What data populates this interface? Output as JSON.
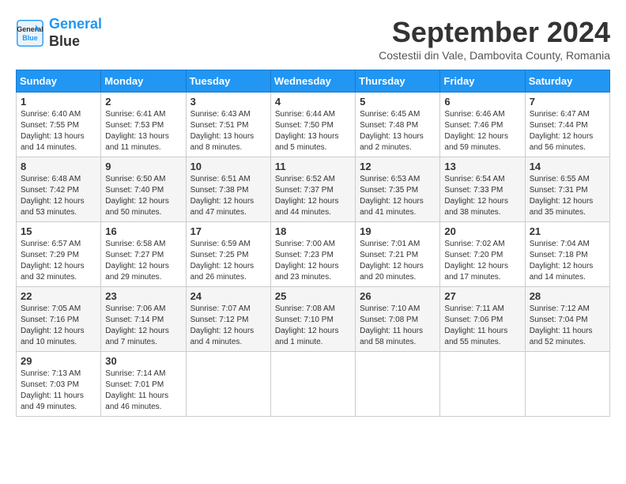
{
  "header": {
    "logo_line1": "General",
    "logo_line2": "Blue",
    "month_year": "September 2024",
    "location": "Costestii din Vale, Dambovita County, Romania"
  },
  "weekdays": [
    "Sunday",
    "Monday",
    "Tuesday",
    "Wednesday",
    "Thursday",
    "Friday",
    "Saturday"
  ],
  "weeks": [
    [
      {
        "day": 1,
        "sunrise": "6:40 AM",
        "sunset": "7:55 PM",
        "daylight": "13 hours and 14 minutes."
      },
      {
        "day": 2,
        "sunrise": "6:41 AM",
        "sunset": "7:53 PM",
        "daylight": "13 hours and 11 minutes."
      },
      {
        "day": 3,
        "sunrise": "6:43 AM",
        "sunset": "7:51 PM",
        "daylight": "13 hours and 8 minutes."
      },
      {
        "day": 4,
        "sunrise": "6:44 AM",
        "sunset": "7:50 PM",
        "daylight": "13 hours and 5 minutes."
      },
      {
        "day": 5,
        "sunrise": "6:45 AM",
        "sunset": "7:48 PM",
        "daylight": "13 hours and 2 minutes."
      },
      {
        "day": 6,
        "sunrise": "6:46 AM",
        "sunset": "7:46 PM",
        "daylight": "12 hours and 59 minutes."
      },
      {
        "day": 7,
        "sunrise": "6:47 AM",
        "sunset": "7:44 PM",
        "daylight": "12 hours and 56 minutes."
      }
    ],
    [
      {
        "day": 8,
        "sunrise": "6:48 AM",
        "sunset": "7:42 PM",
        "daylight": "12 hours and 53 minutes."
      },
      {
        "day": 9,
        "sunrise": "6:50 AM",
        "sunset": "7:40 PM",
        "daylight": "12 hours and 50 minutes."
      },
      {
        "day": 10,
        "sunrise": "6:51 AM",
        "sunset": "7:38 PM",
        "daylight": "12 hours and 47 minutes."
      },
      {
        "day": 11,
        "sunrise": "6:52 AM",
        "sunset": "7:37 PM",
        "daylight": "12 hours and 44 minutes."
      },
      {
        "day": 12,
        "sunrise": "6:53 AM",
        "sunset": "7:35 PM",
        "daylight": "12 hours and 41 minutes."
      },
      {
        "day": 13,
        "sunrise": "6:54 AM",
        "sunset": "7:33 PM",
        "daylight": "12 hours and 38 minutes."
      },
      {
        "day": 14,
        "sunrise": "6:55 AM",
        "sunset": "7:31 PM",
        "daylight": "12 hours and 35 minutes."
      }
    ],
    [
      {
        "day": 15,
        "sunrise": "6:57 AM",
        "sunset": "7:29 PM",
        "daylight": "12 hours and 32 minutes."
      },
      {
        "day": 16,
        "sunrise": "6:58 AM",
        "sunset": "7:27 PM",
        "daylight": "12 hours and 29 minutes."
      },
      {
        "day": 17,
        "sunrise": "6:59 AM",
        "sunset": "7:25 PM",
        "daylight": "12 hours and 26 minutes."
      },
      {
        "day": 18,
        "sunrise": "7:00 AM",
        "sunset": "7:23 PM",
        "daylight": "12 hours and 23 minutes."
      },
      {
        "day": 19,
        "sunrise": "7:01 AM",
        "sunset": "7:21 PM",
        "daylight": "12 hours and 20 minutes."
      },
      {
        "day": 20,
        "sunrise": "7:02 AM",
        "sunset": "7:20 PM",
        "daylight": "12 hours and 17 minutes."
      },
      {
        "day": 21,
        "sunrise": "7:04 AM",
        "sunset": "7:18 PM",
        "daylight": "12 hours and 14 minutes."
      }
    ],
    [
      {
        "day": 22,
        "sunrise": "7:05 AM",
        "sunset": "7:16 PM",
        "daylight": "12 hours and 10 minutes."
      },
      {
        "day": 23,
        "sunrise": "7:06 AM",
        "sunset": "7:14 PM",
        "daylight": "12 hours and 7 minutes."
      },
      {
        "day": 24,
        "sunrise": "7:07 AM",
        "sunset": "7:12 PM",
        "daylight": "12 hours and 4 minutes."
      },
      {
        "day": 25,
        "sunrise": "7:08 AM",
        "sunset": "7:10 PM",
        "daylight": "12 hours and 1 minute."
      },
      {
        "day": 26,
        "sunrise": "7:10 AM",
        "sunset": "7:08 PM",
        "daylight": "11 hours and 58 minutes."
      },
      {
        "day": 27,
        "sunrise": "7:11 AM",
        "sunset": "7:06 PM",
        "daylight": "11 hours and 55 minutes."
      },
      {
        "day": 28,
        "sunrise": "7:12 AM",
        "sunset": "7:04 PM",
        "daylight": "11 hours and 52 minutes."
      }
    ],
    [
      {
        "day": 29,
        "sunrise": "7:13 AM",
        "sunset": "7:03 PM",
        "daylight": "11 hours and 49 minutes."
      },
      {
        "day": 30,
        "sunrise": "7:14 AM",
        "sunset": "7:01 PM",
        "daylight": "11 hours and 46 minutes."
      },
      null,
      null,
      null,
      null,
      null
    ]
  ]
}
